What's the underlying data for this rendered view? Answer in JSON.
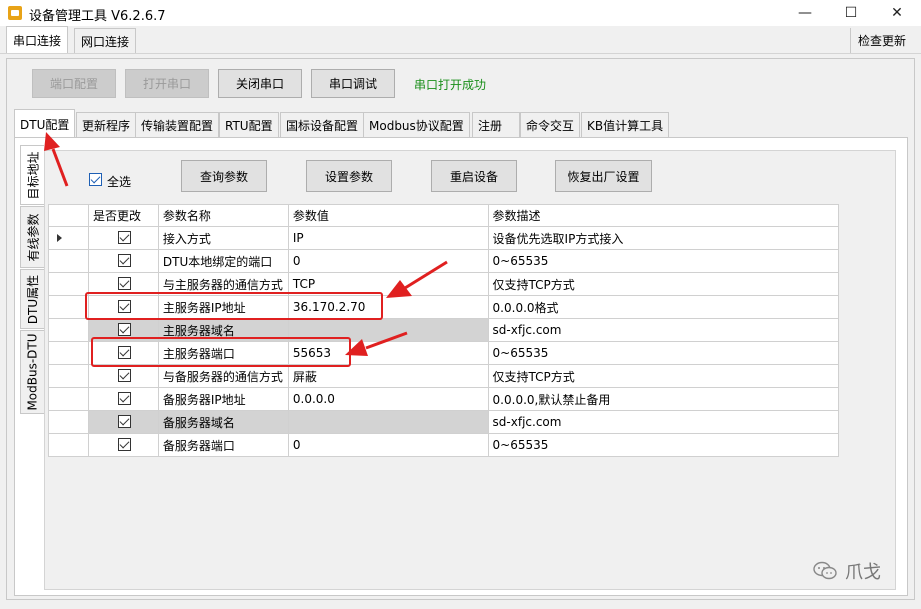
{
  "window": {
    "title": "设备管理工具 V6.2.6.7",
    "minimize": "—",
    "maximize": "☐",
    "close": "✕"
  },
  "top_tabs": [
    "串口连接",
    "网口连接"
  ],
  "check_update": "检查更新",
  "serial_buttons": {
    "port_config": "端口配置",
    "open_port": "打开串口",
    "close_port": "关闭串口",
    "port_debug": "串口调试"
  },
  "serial_status": "串口打开成功",
  "config_tabs": [
    "DTU配置",
    "更新程序",
    "传输装置配置",
    "RTU配置",
    "国标设备配置",
    "Modbus协议配置",
    "注册",
    "命令交互",
    "KB值计算工具"
  ],
  "vertical_tabs": [
    "目标地址",
    "有线参数",
    "DTU属性",
    "ModBus-DTU"
  ],
  "select_all_label": "全选",
  "param_buttons": {
    "query": "查询参数",
    "set": "设置参数",
    "restart": "重启设备",
    "factory_reset": "恢复出厂设置"
  },
  "grid": {
    "headers": [
      "是否更改",
      "参数名称",
      "参数值",
      "参数描述"
    ],
    "rows": [
      {
        "name": "接入方式",
        "value": "IP",
        "desc": "设备优先选取IP方式接入"
      },
      {
        "name": "DTU本地绑定的端口",
        "value": "0",
        "desc": "0~65535"
      },
      {
        "name": "与主服务器的通信方式",
        "value": "TCP",
        "desc": "仅支持TCP方式"
      },
      {
        "name": "主服务器IP地址",
        "value": "36.170.2.70",
        "desc": "0.0.0.0格式"
      },
      {
        "name": "主服务器域名",
        "value": "",
        "desc": "sd-xfjc.com"
      },
      {
        "name": "主服务器端口",
        "value": "55653",
        "desc": "0~65535"
      },
      {
        "name": "与备服务器的通信方式",
        "value": "屏蔽",
        "desc": "仅支持TCP方式"
      },
      {
        "name": "备服务器IP地址",
        "value": "0.0.0.0",
        "desc": "0.0.0.0,默认禁止备用"
      },
      {
        "name": "备服务器域名",
        "value": "",
        "desc": "sd-xfjc.com"
      },
      {
        "name": "备服务器端口",
        "value": "0",
        "desc": "0~65535"
      }
    ]
  },
  "watermark": "爪戈",
  "colors": {
    "status_green": "#1a8f1a",
    "annotation_red": "#e02020",
    "checkbox_blue": "#1e5fb4"
  }
}
